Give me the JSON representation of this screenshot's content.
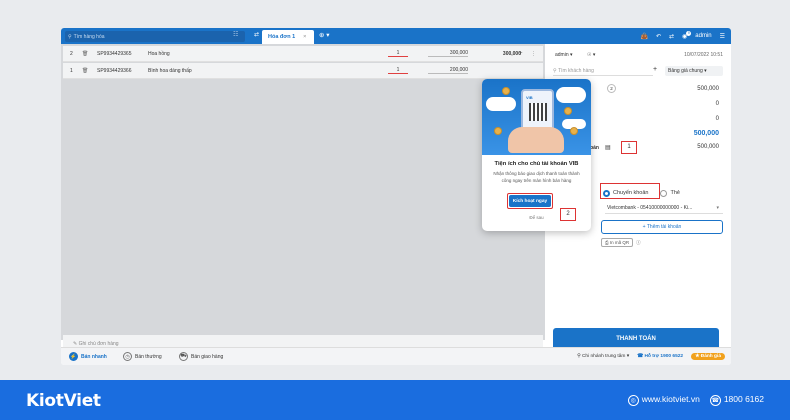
{
  "topbar": {
    "search_placeholder": "Tìm hàng hóa",
    "active_tab": "Hóa đơn 1",
    "user": "admin",
    "notif_count": "9"
  },
  "cart": {
    "items": [
      {
        "idx": "2",
        "code": "SP9934429365",
        "name": "Hoa hồng",
        "qty": "1",
        "price": "300,000",
        "total": "300,000"
      },
      {
        "idx": "1",
        "code": "SP9934429366",
        "name": "Bình hoa dáng thấp",
        "qty": "1",
        "price": "200,000",
        "total": ""
      }
    ],
    "note_placeholder": "Ghi chú đơn hàng"
  },
  "right": {
    "seller": "admin",
    "datetime": "10/07/2022  10:51",
    "customer_placeholder": "Tìm khách hàng",
    "pricebook": "Bảng giá chung",
    "count_badge": "2",
    "subtotal": "500,000",
    "discount": "0",
    "other": "0",
    "to_pay": "500,000",
    "paid_label": "Khách thanh toán",
    "paid": "500,000",
    "radio_transfer": "Chuyển khoản",
    "radio_card": "Thẻ",
    "bank": "Vietcombank - 05410000000000 - Ki...",
    "add_account": "+ Thêm tài khoản",
    "print_qr": "In mã QR",
    "pay_button": "THANH TOÁN"
  },
  "popup": {
    "title": "Tiện ích cho chủ tài khoản VIB",
    "desc": "Nhận thông báo giao dịch thanh toán thành công ngay trên màn hình bán hàng",
    "activate": "Kích hoạt ngay",
    "later": "Để sau",
    "brand": "VIB"
  },
  "steps": {
    "one": "1",
    "two": "2"
  },
  "bottom": {
    "mode_fast": "Bán nhanh",
    "mode_normal": "Bán thường",
    "mode_delivery": "Bán giao hàng",
    "branch": "Chi nhánh trung tâm",
    "hotline": "Hỗ trợ 1900 6522",
    "eval": "Đánh giá"
  },
  "footer": {
    "logo": "KiotViet",
    "website": "www.kiotviet.vn",
    "phone": "1800 6162"
  },
  "colors": {
    "primary": "#1a73c8",
    "highlight": "#dd3333",
    "footer": "#1a6ddf"
  }
}
